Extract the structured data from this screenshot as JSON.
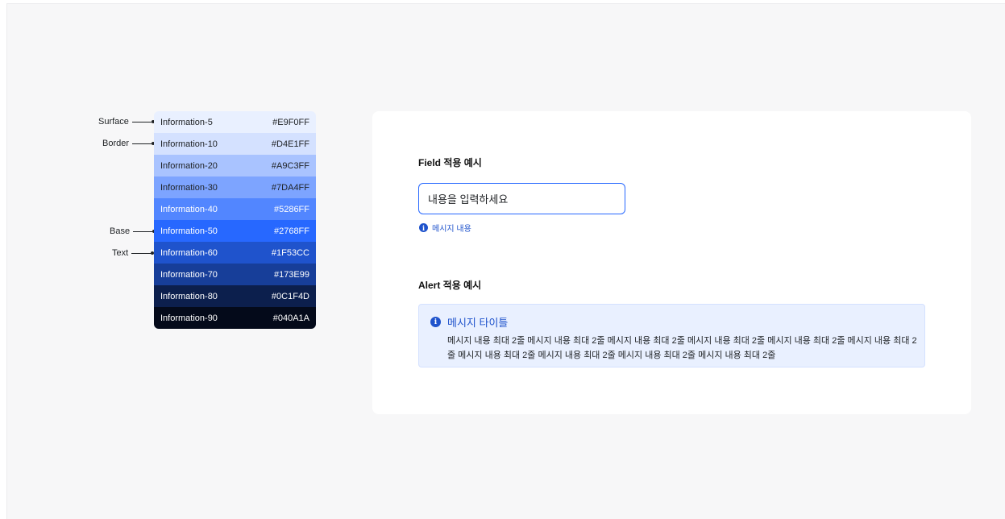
{
  "palette": {
    "swatches": [
      {
        "name": "Information-5",
        "hex": "#E9F0FF",
        "bg": "#E9F0FF",
        "fg": "#1e2124"
      },
      {
        "name": "Information-10",
        "hex": "#D4E1FF",
        "bg": "#D4E1FF",
        "fg": "#1e2124"
      },
      {
        "name": "Information-20",
        "hex": "#A9C3FF",
        "bg": "#A9C3FF",
        "fg": "#1e2124"
      },
      {
        "name": "Information-30",
        "hex": "#7DA4FF",
        "bg": "#7DA4FF",
        "fg": "#1e2124"
      },
      {
        "name": "Information-40",
        "hex": "#5286FF",
        "bg": "#5286FF",
        "fg": "#ffffff"
      },
      {
        "name": "Information-50",
        "hex": "#2768FF",
        "bg": "#2768FF",
        "fg": "#ffffff"
      },
      {
        "name": "Information-60",
        "hex": "#1F53CC",
        "bg": "#1F53CC",
        "fg": "#ffffff"
      },
      {
        "name": "Information-70",
        "hex": "#173E99",
        "bg": "#173E99",
        "fg": "#ffffff"
      },
      {
        "name": "Information-80",
        "hex": "#0C1F4D",
        "bg": "#0C1F4D",
        "fg": "#ffffff"
      },
      {
        "name": "Information-90",
        "hex": "#040A1A",
        "bg": "#040A1A",
        "fg": "#ffffff"
      }
    ],
    "role_labels": {
      "surface": "Surface",
      "border": "Border",
      "base": "Base",
      "text": "Text"
    }
  },
  "field_example": {
    "title": "Field  적용 예시",
    "input_value": "내용을 입력하세요",
    "helper_icon": "info-icon",
    "helper_text": "메시지 내용"
  },
  "alert_example": {
    "title": "Alert 적용 예시",
    "alert_icon": "info-icon",
    "alert_title": "메시지 타이틀",
    "alert_body": "메시지 내용 최대 2줄 메시지 내용 최대 2줄 메시지 내용 최대 2줄 메시지 내용 최대 2줄 메시지 내용 최대 2줄 메시지 내용 최대 2줄 메시지 내용 최대 2줄 메시지 내용 최대 2줄 메시지 내용 최대 2줄 메시지 내용 최대 2줄"
  },
  "colors": {
    "accent": "#2768FF",
    "text_accent": "#1F53CC",
    "canvas": "#F7F7F8",
    "card": "#FFFFFF"
  }
}
